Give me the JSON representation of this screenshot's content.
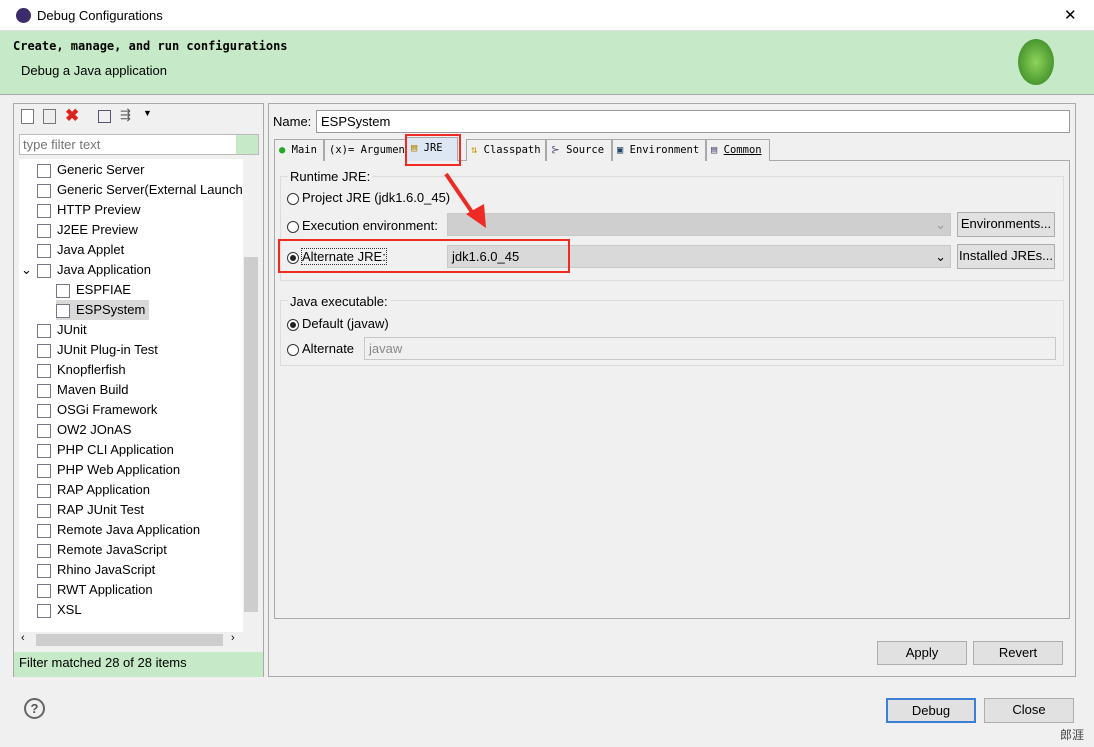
{
  "window": {
    "title": "Debug Configurations",
    "close": "✕"
  },
  "banner": {
    "heading": "Create, manage, and run configurations",
    "subtitle": "Debug a Java application"
  },
  "left": {
    "filter_placeholder": "type filter text",
    "status": "Filter matched 28 of 28 items",
    "items": [
      {
        "label": "Generic Server",
        "icon": "server-icon",
        "level": 1
      },
      {
        "label": "Generic Server(External Launch)",
        "icon": "server-icon",
        "level": 1
      },
      {
        "label": "HTTP Preview",
        "icon": "server-icon",
        "level": 1
      },
      {
        "label": "J2EE Preview",
        "icon": "server-icon",
        "level": 1
      },
      {
        "label": "Java Applet",
        "icon": "applet-icon",
        "level": 1
      },
      {
        "label": "Java Application",
        "icon": "java-app-icon",
        "level": 1,
        "expanded": true
      },
      {
        "label": "ESPFIAE",
        "icon": "java-file-icon",
        "level": 2
      },
      {
        "label": "ESPSystem",
        "icon": "java-file-icon",
        "level": 2,
        "selected": true
      },
      {
        "label": "JUnit",
        "icon": "junit-icon",
        "level": 1
      },
      {
        "label": "JUnit Plug-in Test",
        "icon": "junit-plugin-icon",
        "level": 1
      },
      {
        "label": "Knopflerfish",
        "icon": "knopflerfish-icon",
        "level": 1
      },
      {
        "label": "Maven Build",
        "icon": "maven-icon",
        "level": 1
      },
      {
        "label": "OSGi Framework",
        "icon": "osgi-icon",
        "level": 1
      },
      {
        "label": "OW2 JOnAS",
        "icon": "jonas-icon",
        "level": 1
      },
      {
        "label": "PHP CLI Application",
        "icon": "php-icon",
        "level": 1
      },
      {
        "label": "PHP Web Application",
        "icon": "php-web-icon",
        "level": 1
      },
      {
        "label": "RAP Application",
        "icon": "rap-icon",
        "level": 1
      },
      {
        "label": "RAP JUnit Test",
        "icon": "rap-junit-icon",
        "level": 1
      },
      {
        "label": "Remote Java Application",
        "icon": "remote-java-icon",
        "level": 1
      },
      {
        "label": "Remote JavaScript",
        "icon": "remote-js-icon",
        "level": 1
      },
      {
        "label": "Rhino JavaScript",
        "icon": "rhino-icon",
        "level": 1
      },
      {
        "label": "RWT Application",
        "icon": "rwt-icon",
        "level": 1
      },
      {
        "label": "XSL",
        "icon": "xsl-icon",
        "level": 1
      }
    ]
  },
  "right": {
    "name_label": "Name:",
    "name_value": "ESPSystem",
    "tabs": [
      {
        "label": "Main"
      },
      {
        "label": "Arguments"
      },
      {
        "label": "JRE",
        "active": true
      },
      {
        "label": "Classpath"
      },
      {
        "label": "Source"
      },
      {
        "label": "Environment"
      },
      {
        "label": "Common"
      }
    ],
    "runtime_group": "Runtime JRE:",
    "project_jre": "Project JRE (jdk1.6.0_45)",
    "exec_env": "Execution environment:",
    "environments_btn": "Environments...",
    "alternate_jre": "Alternate JRE:",
    "alternate_value": "jdk1.6.0_45",
    "installed_btn": "Installed JREs...",
    "exec_group": "Java executable:",
    "default_opt": "Default (javaw)",
    "alternate_opt": "Alternate",
    "alternate_exec_value": "javaw",
    "apply": "Apply",
    "revert": "Revert"
  },
  "footer": {
    "debug": "Debug",
    "close": "Close",
    "help": "?",
    "watermark": "郎涯"
  },
  "colors": {
    "banner": "#c6eac8",
    "highlight": "#ee2a24"
  }
}
